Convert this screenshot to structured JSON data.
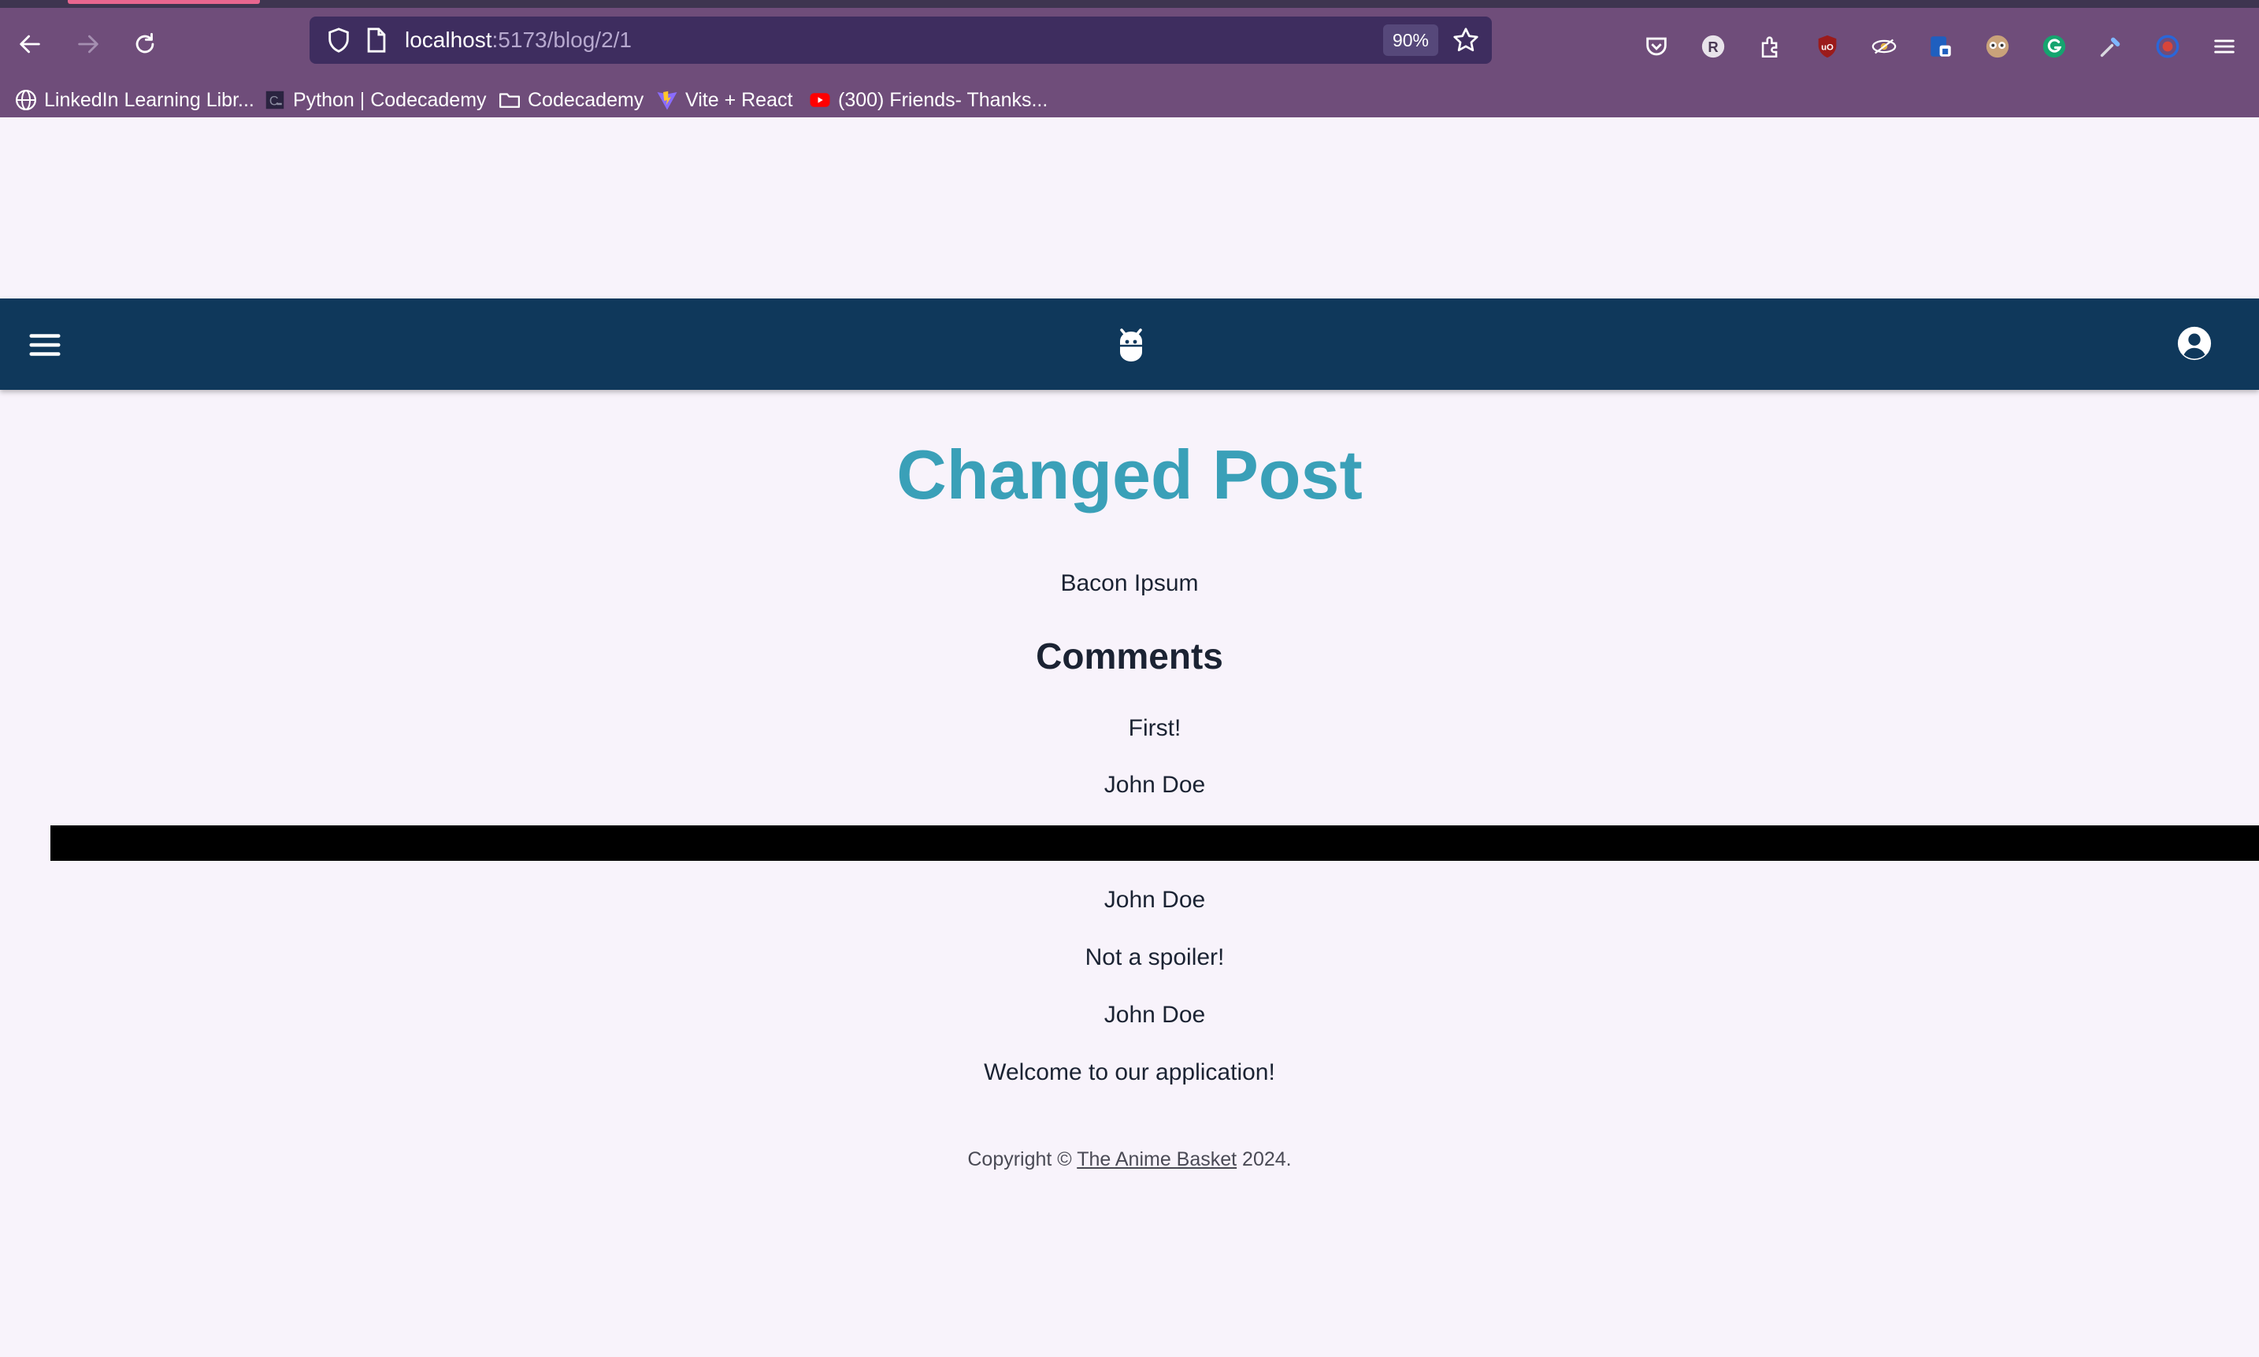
{
  "browser": {
    "url_host": "localhost",
    "url_path": ":5173/blog/2/1",
    "zoom": "90%",
    "bookmarks": [
      {
        "label": "LinkedIn Learning Libr...",
        "icon": "globe-icon"
      },
      {
        "label": "Python | Codecademy",
        "icon": "codecademy-icon"
      },
      {
        "label": "Codecademy",
        "icon": "folder-icon"
      },
      {
        "label": "Vite + React",
        "icon": "vite-icon"
      },
      {
        "label": "(300) Friends- Thanks...",
        "icon": "youtube-icon"
      }
    ],
    "extensions": [
      "pocket-icon",
      "r-extension-icon",
      "extensions-icon",
      "ublock-icon",
      "eye-extension-icon",
      "shield-extension-icon",
      "owl-extension-icon",
      "grammarly-icon",
      "eyedropper-icon",
      "target-extension-icon",
      "menu-icon"
    ]
  },
  "post": {
    "title": "Changed Post",
    "body": "Bacon Ipsum",
    "comments_heading": "Comments",
    "comments": [
      {
        "text": "First!",
        "author": "John Doe"
      },
      {
        "text": "",
        "author": "John Doe"
      },
      {
        "text": "Not a spoiler!",
        "author": "John Doe"
      }
    ],
    "welcome": "Welcome to our application!"
  },
  "footer": {
    "prefix": "Copyright © ",
    "link": "The Anime Basket",
    "suffix": " 2024."
  },
  "colors": {
    "appbar": "#0f385b",
    "title": "#3aa0b8",
    "page_bg": "#f8f3fb",
    "chrome": "#6f4d7a"
  }
}
